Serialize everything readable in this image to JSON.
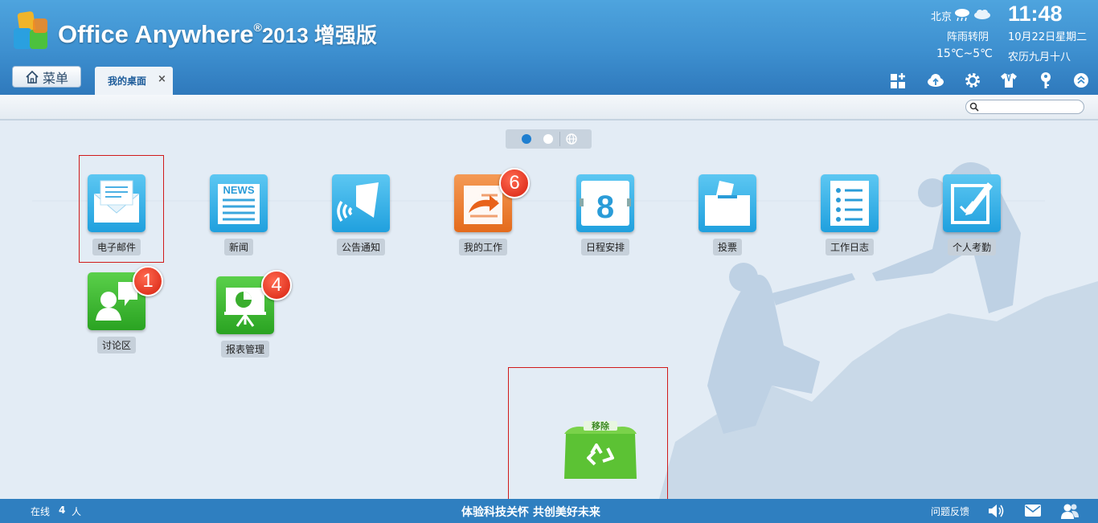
{
  "header": {
    "brand_name": "Office Anywhere",
    "brand_reg": "®",
    "brand_version": "2013 增强版"
  },
  "weather": {
    "city": "北京",
    "condition": "阵雨转阴",
    "temperature": "15℃~5℃",
    "icons": [
      "rain-cloud-icon",
      "cloud-icon"
    ]
  },
  "datetime": {
    "time": "11:48",
    "date": "10月22日星期二",
    "lunar": "农历九月十八"
  },
  "nav": {
    "menu_label": "菜单",
    "menu_icon": "home-icon",
    "tabs": [
      {
        "label": "我的桌面",
        "close": "×"
      }
    ]
  },
  "toolbar": {
    "icons": [
      "add-widget-icon",
      "cloud-upload-icon",
      "settings-gear-icon",
      "theme-shirt-icon",
      "key-icon",
      "collapse-up-icon"
    ]
  },
  "search": {
    "placeholder": ""
  },
  "pager": {
    "pages": 2,
    "current": 1,
    "extra_icon": "globe-icon"
  },
  "apps": [
    {
      "label": "电子邮件",
      "icon": "email-icon",
      "color": "blue",
      "badge": null,
      "selected": true
    },
    {
      "label": "新闻",
      "icon": "news-icon",
      "color": "blue",
      "badge": null,
      "icon_text": "NEWS"
    },
    {
      "label": "公告通知",
      "icon": "announcement-bell-icon",
      "color": "blue",
      "badge": null
    },
    {
      "label": "我的工作",
      "icon": "my-work-icon",
      "color": "orange",
      "badge": "6"
    },
    {
      "label": "日程安排",
      "icon": "calendar-icon",
      "color": "blue",
      "badge": null,
      "icon_text": "8"
    },
    {
      "label": "投票",
      "icon": "vote-box-icon",
      "color": "blue",
      "badge": null
    },
    {
      "label": "工作日志",
      "icon": "work-log-list-icon",
      "color": "blue",
      "badge": null
    },
    {
      "label": "个人考勤",
      "icon": "attendance-edit-icon",
      "color": "blue",
      "badge": null
    },
    {
      "label": "讨论区",
      "icon": "discussion-icon",
      "color": "green",
      "badge": "1"
    },
    {
      "label": "报表管理",
      "icon": "report-chart-icon",
      "color": "green",
      "badge": "4"
    }
  ],
  "trash": {
    "label": "移除",
    "icon": "recycle-bin-icon"
  },
  "footer": {
    "online_prefix": "在线",
    "online_count": "4",
    "online_suffix": "人",
    "slogan": "体验科技关怀  共创美好未来",
    "feedback": "问题反馈",
    "icons": [
      "volume-icon",
      "message-icon",
      "users-icon"
    ]
  }
}
